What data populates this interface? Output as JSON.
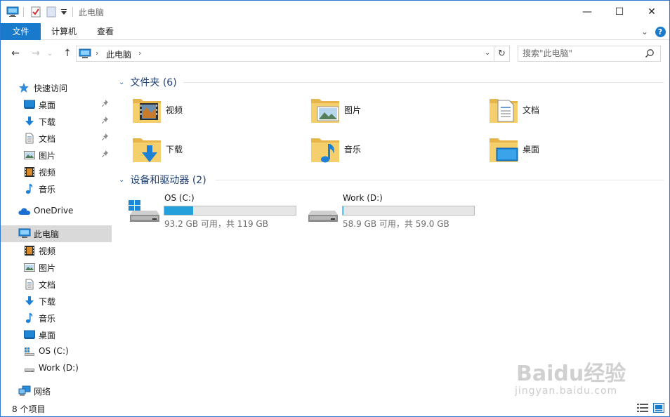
{
  "window": {
    "title": "此电脑",
    "minimize_glyph": "—",
    "maximize_glyph": "☐",
    "close_glyph": "✕"
  },
  "ribbon": {
    "tabs": [
      {
        "label": "文件",
        "active": true
      },
      {
        "label": "计算机",
        "active": false
      },
      {
        "label": "查看",
        "active": false
      }
    ],
    "expand_glyph": "⌄",
    "help_glyph": "?"
  },
  "nav": {
    "back_glyph": "←",
    "forward_glyph": "→",
    "recent_glyph": "⌄",
    "up_glyph": "↑",
    "breadcrumb": "此电脑",
    "crumb_sep": "›",
    "dropdown_glyph": "⌄",
    "refresh_glyph": "↻",
    "search_placeholder": "搜索\"此电脑\""
  },
  "sidebar": {
    "quick_access": "快速访问",
    "quick_items": [
      {
        "label": "桌面",
        "icon": "desktop-icon",
        "pinned": true
      },
      {
        "label": "下载",
        "icon": "download-icon",
        "pinned": true
      },
      {
        "label": "文档",
        "icon": "document-icon",
        "pinned": true
      },
      {
        "label": "图片",
        "icon": "picture-icon",
        "pinned": true
      },
      {
        "label": "视频",
        "icon": "video-icon",
        "pinned": false
      },
      {
        "label": "音乐",
        "icon": "music-icon",
        "pinned": false
      }
    ],
    "onedrive": "OneDrive",
    "this_pc": "此电脑",
    "pc_items": [
      {
        "label": "视频",
        "icon": "video-icon"
      },
      {
        "label": "图片",
        "icon": "picture-icon"
      },
      {
        "label": "文档",
        "icon": "document-icon"
      },
      {
        "label": "下载",
        "icon": "download-icon"
      },
      {
        "label": "音乐",
        "icon": "music-icon"
      },
      {
        "label": "桌面",
        "icon": "desktop-icon"
      },
      {
        "label": "OS (C:)",
        "icon": "windows-drive-icon"
      },
      {
        "label": "Work (D:)",
        "icon": "drive-icon"
      }
    ],
    "network": "网络",
    "pin_glyph": "📌"
  },
  "content": {
    "folders_header": "文件夹 (6)",
    "folders": [
      {
        "label": "视频",
        "icon": "video-folder-icon"
      },
      {
        "label": "图片",
        "icon": "picture-folder-icon"
      },
      {
        "label": "文档",
        "icon": "document-folder-icon"
      },
      {
        "label": "下载",
        "icon": "download-folder-icon"
      },
      {
        "label": "音乐",
        "icon": "music-folder-icon"
      },
      {
        "label": "桌面",
        "icon": "desktop-folder-icon"
      }
    ],
    "drives_header": "设备和驱动器 (2)",
    "drives": [
      {
        "name": "OS (C:)",
        "free": "93.2 GB 可用，共 119 GB",
        "used_fraction": 0.217,
        "icon": "windows-drive-icon"
      },
      {
        "name": "Work (D:)",
        "free": "58.9 GB 可用，共 59.0 GB",
        "used_fraction": 0.002,
        "icon": "drive-icon"
      }
    ],
    "chevron_glyph": "⌄"
  },
  "status": {
    "item_count": "8 个项目"
  },
  "watermark": {
    "brand": "Baidu经验",
    "url": "jingyan.baidu.com"
  },
  "colors": {
    "accent": "#1979ca",
    "folder": "#f2c55c",
    "drive_fill": "#26a0da",
    "header_text": "#1e3f77"
  }
}
